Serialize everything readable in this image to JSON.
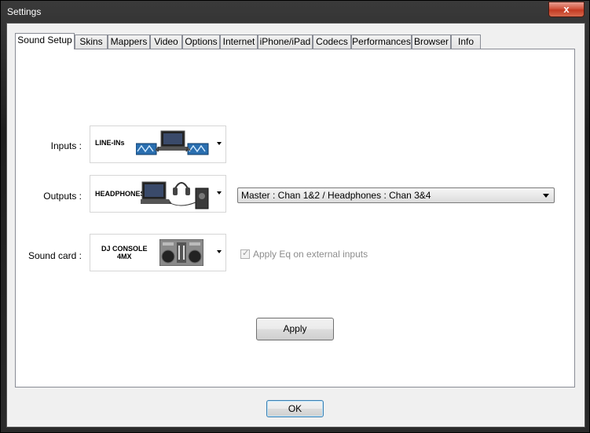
{
  "window": {
    "title": "Settings",
    "close_glyph": "x"
  },
  "tabs": [
    {
      "label": "Sound Setup",
      "active": true
    },
    {
      "label": "Skins"
    },
    {
      "label": "Mappers"
    },
    {
      "label": "Video"
    },
    {
      "label": "Options"
    },
    {
      "label": "Internet"
    },
    {
      "label": "iPhone/iPad"
    },
    {
      "label": "Codecs"
    },
    {
      "label": "Performances"
    },
    {
      "label": "Browser"
    },
    {
      "label": "Info"
    }
  ],
  "inputs": {
    "label": "Inputs :",
    "device_text": "LINE-INs"
  },
  "outputs": {
    "label": "Outputs :",
    "device_text": "HEADPHONES",
    "routing_value": "Master : Chan 1&2 / Headphones : Chan 3&4"
  },
  "soundcard": {
    "label": "Sound card :",
    "device_text_line1": "DJ CONSOLE",
    "device_text_line2": "4MX"
  },
  "apply_eq": {
    "label": "Apply Eq on external inputs",
    "checked": true,
    "disabled": true
  },
  "buttons": {
    "apply": "Apply",
    "ok": "OK"
  }
}
